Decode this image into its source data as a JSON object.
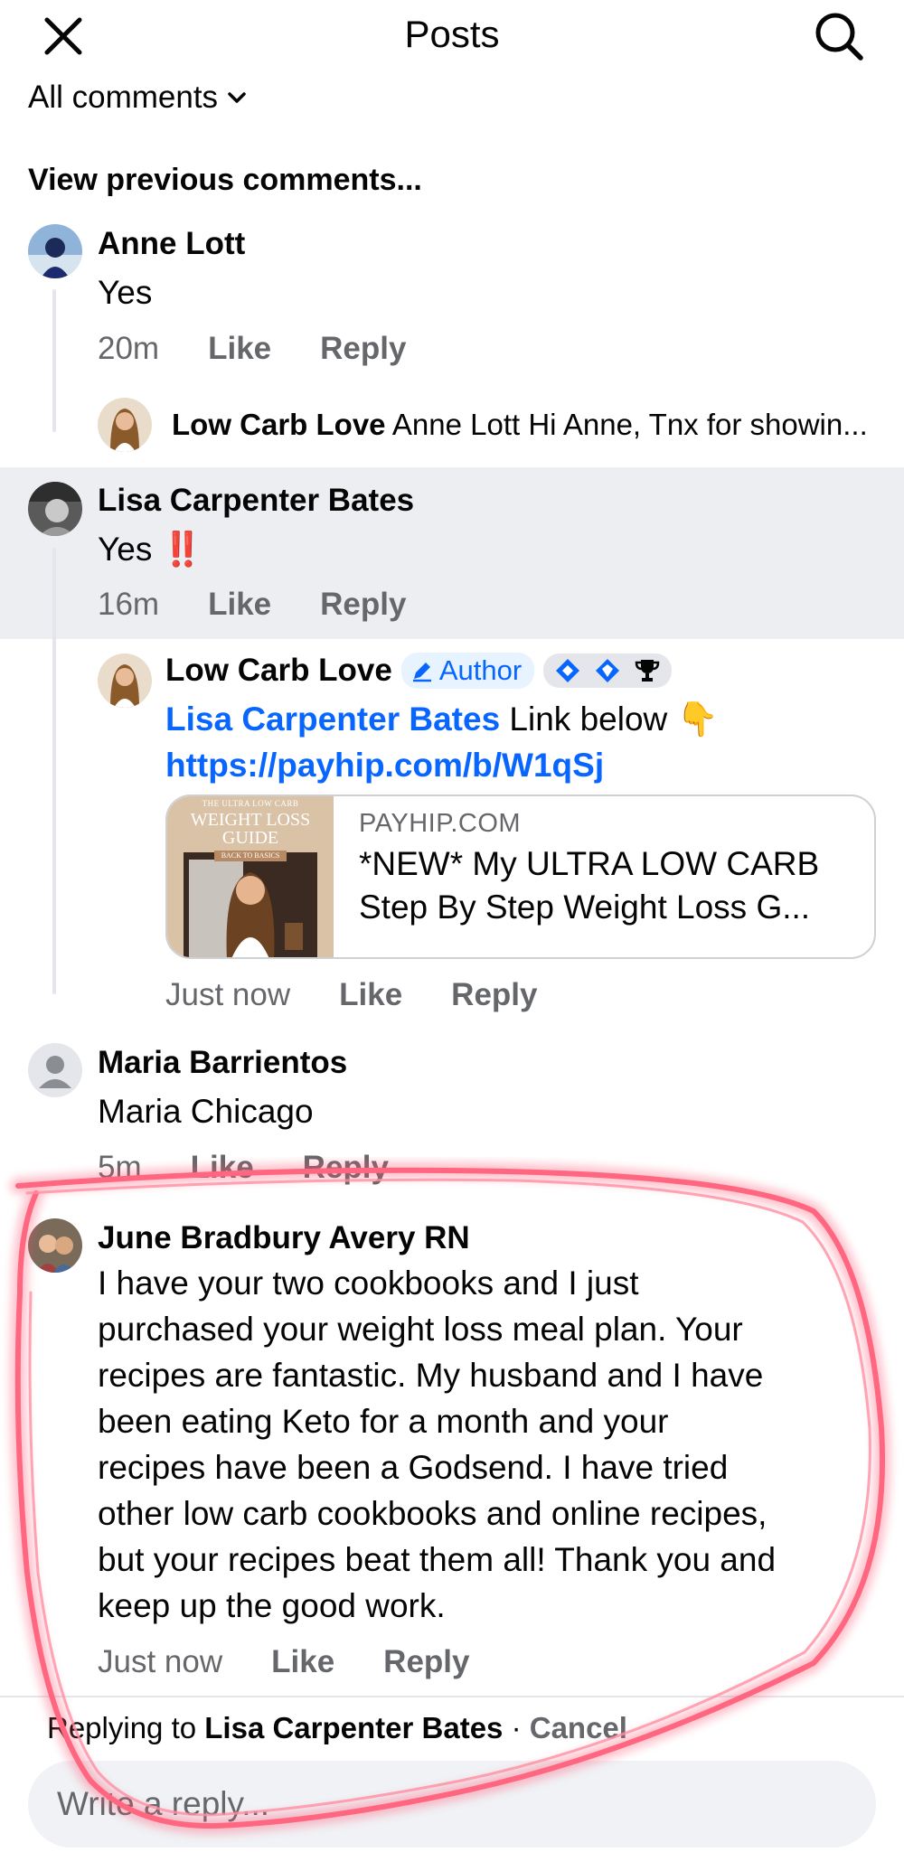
{
  "header": {
    "title": "Posts",
    "close_icon": "close-icon",
    "search_icon": "search-icon"
  },
  "filter": {
    "label": "All comments"
  },
  "view_previous": "View previous comments...",
  "comments": [
    {
      "author": "Anne Lott",
      "text": "Yes",
      "time": "20m",
      "like": "Like",
      "reply": "Reply",
      "reply_preview": {
        "author": "Low Carb Love",
        "text": "Anne Lott Hi Anne, Tnx for showin..."
      }
    },
    {
      "author": "Lisa Carpenter Bates",
      "text": "Yes",
      "emoji": "‼️",
      "time": "16m",
      "like": "Like",
      "reply": {
        "author": "Low Carb Love",
        "badge": "Author",
        "mention": "Lisa Carpenter Bates",
        "text": " Link below 👇",
        "link": "https://payhip.com/b/W1qSj",
        "card": {
          "domain": "PAYHIP.COM",
          "title_line1": "*NEW* My ULTRA LOW CARB",
          "title_line2": "Step By Step Weight Loss G...",
          "thumb_line1": "THE ULTRA LOW CARB",
          "thumb_line2": "WEIGHT LOSS",
          "thumb_line3": "GUIDE",
          "thumb_line4": "BACK TO BASICS"
        },
        "time": "Just now",
        "like": "Like",
        "reply": "Reply"
      },
      "highlighted": true
    },
    {
      "author": "Maria Barrientos",
      "text": "Maria Chicago",
      "time": "5m",
      "like": "Like",
      "reply": "Reply"
    },
    {
      "author": "June Bradbury Avery RN",
      "lines": [
        "I have your two cookbooks and I just",
        "purchased your weight loss meal plan. Your",
        "recipes are fantastic. My husband and I have",
        "been eating Keto for a month and your",
        "recipes have been a Godsend. I have tried",
        "other low carb cookbooks and online recipes,",
        "but your recipes beat them all! Thank you and",
        "keep up the good work."
      ],
      "time": "Just now",
      "like": "Like",
      "reply": "Reply"
    }
  ],
  "composer": {
    "replying_prefix": "Replying to ",
    "replying_to": "Lisa Carpenter Bates",
    "separator": " · ",
    "cancel": "Cancel",
    "placeholder": "Write a reply..."
  },
  "colors": {
    "accent": "#0866ff",
    "secondary_text": "#65676b",
    "highlight": "#eceef2",
    "annotation": "#ff4d6d"
  }
}
